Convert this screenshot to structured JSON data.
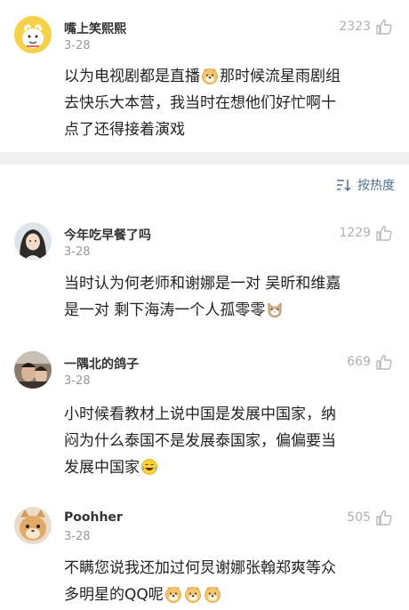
{
  "sort": {
    "label": "按热度"
  },
  "comments": [
    {
      "username": "嘴上笑熙熙",
      "date": "3-28",
      "likes": "2323",
      "lines": [
        "以为电视剧都是直播",
        "那时候流星雨剧组",
        "去快乐大本营，我当时在想他们好忙啊十",
        "点了还得接着演戏"
      ],
      "emojis": [
        "doge-emoji"
      ]
    },
    {
      "username": "今年吃早餐了吗",
      "date": "3-28",
      "likes": "1229",
      "lines": [
        "当时认为何老师和谢娜是一对 吴昕和维嘉",
        "是一对 剩下海涛一个人孤零零"
      ],
      "emojis": [
        "cat-emoji"
      ]
    },
    {
      "username": "一隅北的鸽子",
      "date": "3-28",
      "likes": "669",
      "lines": [
        "小时候看教材上说中国是发展中国家，纳",
        "闷为什么泰国不是发展泰国家，偏偏要当",
        "发展中国家"
      ],
      "emojis": [
        "laugh-cry-emoji"
      ]
    },
    {
      "username": "Poohher",
      "date": "3-28",
      "likes": "505",
      "lines": [
        "不瞒您说我还加过何炅谢娜张翰郑爽等众",
        "多明星的QQ呢"
      ],
      "emojis": [
        "doge-emoji",
        "doge-emoji",
        "doge-emoji"
      ]
    }
  ]
}
